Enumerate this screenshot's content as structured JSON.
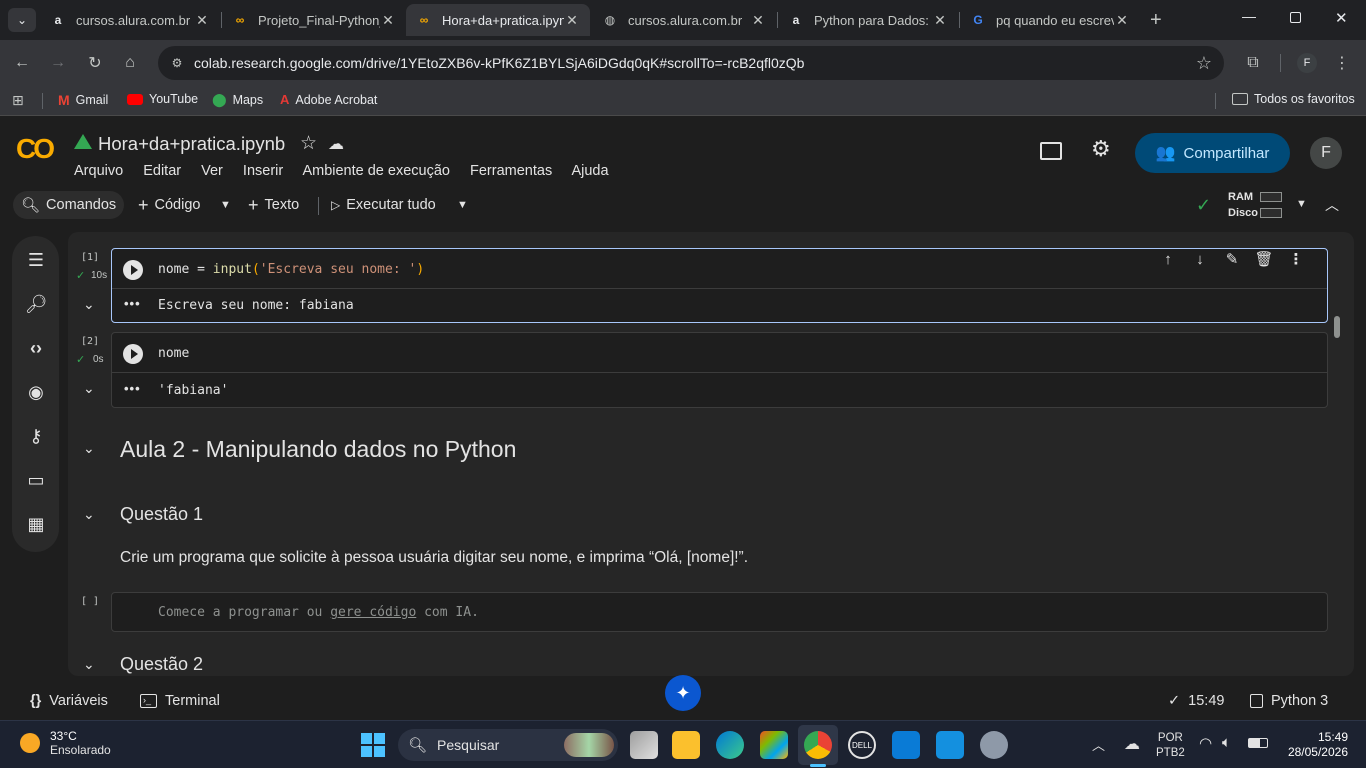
{
  "browser": {
    "tabs": [
      {
        "title": "cursos.alura.com.br",
        "favicon": "alura-icon",
        "active": false
      },
      {
        "title": "Projeto_Final-Python_",
        "favicon": "colab-icon",
        "active": false
      },
      {
        "title": "Hora+da+pratica.ipyn",
        "favicon": "colab-icon",
        "active": true
      },
      {
        "title": "cursos.alura.com.br",
        "favicon": "globe-icon",
        "active": false
      },
      {
        "title": "Python para Dados: p",
        "favicon": "alura-icon",
        "active": false
      },
      {
        "title": "pq quando eu escrev",
        "favicon": "google-icon",
        "active": false
      }
    ],
    "url": "colab.research.google.com/drive/1YEtoZXB6v-kPfK6Z1BYLSjA6iDGdq0qK#scrollTo=-rcB2qfl0zQb",
    "profile_initial": "F",
    "bookmarks": [
      "Gmail",
      "YouTube",
      "Maps",
      "Adobe Acrobat"
    ],
    "all_bookmarks": "Todos os favoritos"
  },
  "colab": {
    "logo": "CO",
    "filename": "Hora+da+pratica.ipynb",
    "menu": [
      "Arquivo",
      "Editar",
      "Ver",
      "Inserir",
      "Ambiente de execução",
      "Ferramentas",
      "Ajuda"
    ],
    "share_label": "Compartilhar",
    "avatar_initial": "F",
    "toolbar": {
      "commands": "Comandos",
      "code": "Código",
      "text": "Texto",
      "run_all": "Executar tudo",
      "ram": "RAM",
      "disk": "Disco"
    },
    "accent": "#004a77"
  },
  "cells": [
    {
      "count": "[1]",
      "time": "10s",
      "code": "nome = input('Escreva seu nome: ')",
      "output": "Escreva seu nome: fabiana"
    },
    {
      "count": "[2]",
      "time": "0s",
      "code": "nome",
      "output": "'fabiana'"
    }
  ],
  "code1": {
    "fn": "nome = ",
    "call": "input",
    "paren": "(",
    "str": "'Escreva seu nome: '",
    "close": ")"
  },
  "section": {
    "heading": "Aula 2 - Manipulando dados no Python",
    "q1": "Questão 1",
    "q1_text": "Crie um programa que solicite à pessoa usuária digitar seu nome, e imprima “Olá, [nome]!”.",
    "empty_count": "[ ]",
    "placeholder_a": "Comece a programar ou ",
    "placeholder_link": "gere código",
    "placeholder_b": " com IA.",
    "q2": "Questão 2"
  },
  "status": {
    "variables": "Variáveis",
    "terminal": "Terminal",
    "time": "15:49",
    "kernel": "Python 3"
  },
  "taskbar": {
    "temp": "33°C",
    "weather": "Ensolarado",
    "search": "Pesquisar",
    "lang1": "POR",
    "lang2": "PTB2",
    "clock": "15:49",
    "date": "28/05/2026"
  }
}
